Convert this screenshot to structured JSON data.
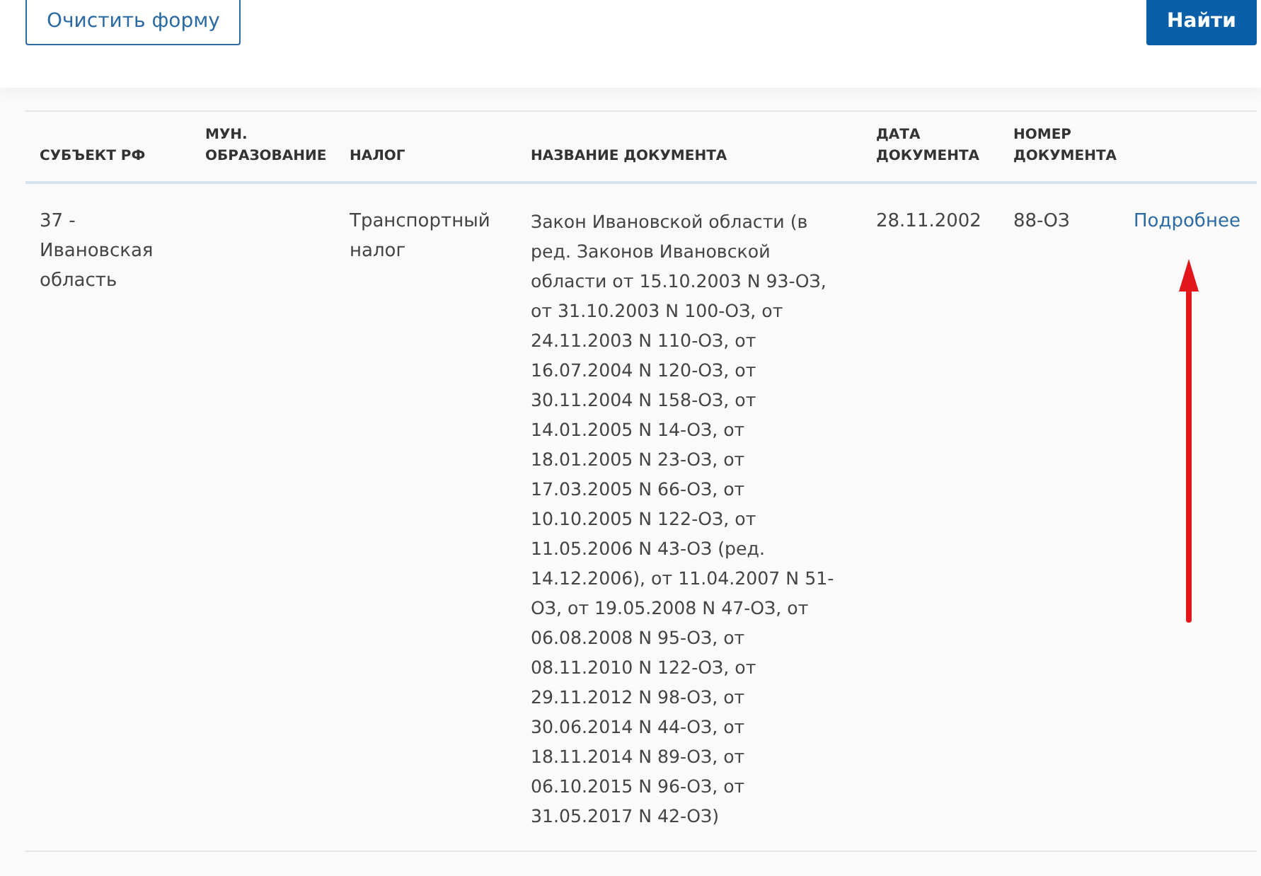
{
  "form_buttons": {
    "clear": "Очистить форму",
    "search": "Найти"
  },
  "table": {
    "columns": [
      "СУБЪЕКТ РФ",
      "МУН. ОБРАЗОВАНИЕ",
      "НАЛОГ",
      "НАЗВАНИЕ ДОКУМЕНТА",
      "ДАТА ДОКУМЕНТА",
      "НОМЕР ДОКУМЕНТА"
    ],
    "rows": [
      {
        "cells": [
          "37 - Ивановская область",
          "",
          "Транспортный налог",
          "Закон Ивановской области (в ред. Законов Ивановской области от 15.10.2003 N 93-ОЗ, от 31.10.2003 N 100-ОЗ, от 24.11.2003 N 110-ОЗ, от 16.07.2004 N 120-ОЗ, от 30.11.2004 N 158-ОЗ, от 14.01.2005 N 14-ОЗ, от 18.01.2005 N 23-ОЗ, от 17.03.2005 N 66-ОЗ, от 10.10.2005 N 122-ОЗ, от 11.05.2006 N 43-ОЗ (ред. 14.12.2006), от 11.04.2007 N 51-ОЗ, от 19.05.2008 N 47-ОЗ, от 06.08.2008 N 95-ОЗ, от 08.11.2010 N 122-ОЗ, от 29.11.2012 N 98-ОЗ, от 30.06.2014 N 44-ОЗ, от 18.11.2014 N 89-ОЗ, от 06.10.2015 N 96-ОЗ, от 31.05.2017 N 42-ОЗ)",
          "28.11.2002",
          "88-ОЗ"
        ],
        "link": "Подробнее"
      }
    ]
  }
}
